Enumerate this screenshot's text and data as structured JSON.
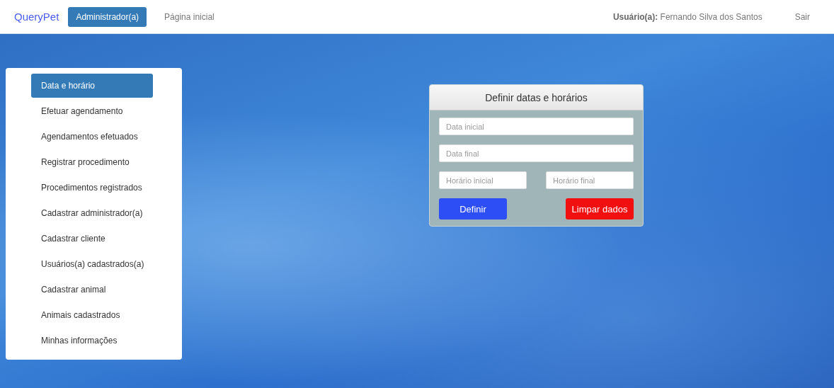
{
  "navbar": {
    "brand": "QueryPet",
    "tabs": [
      {
        "label": "Administrador(a)",
        "selected": true
      },
      {
        "label": "Página inicial",
        "selected": false
      }
    ],
    "user": "**Usuário(a):** Fernando Silva dos Santos",
    "logout": "Sair"
  },
  "sidebar": {
    "items": [
      {
        "label": "Data e horário",
        "selected": true
      },
      {
        "label": "Efetuar agendamento",
        "selected": false
      },
      {
        "label": "Agendamentos efetuados",
        "selected": false
      },
      {
        "label": "Registrar procedimento",
        "selected": false
      },
      {
        "label": "Procedimentos registrados",
        "selected": false
      },
      {
        "label": "Cadastrar administrador(a)",
        "selected": false
      },
      {
        "label": "Cadastrar cliente",
        "selected": false
      },
      {
        "label": "Usuários(a) cadastrados(a)",
        "selected": false
      },
      {
        "label": "Cadastrar animal",
        "selected": false
      },
      {
        "label": "Animais cadastrados",
        "selected": false
      },
      {
        "label": "Minhas informações",
        "selected": false
      }
    ]
  },
  "form": {
    "title": "Definir datas e horários",
    "fields": [
      {
        "placeholder": "Data inicial"
      },
      {
        "placeholder": "Data final"
      }
    ],
    "time_fields": [
      {
        "placeholder": "Horário inicial"
      },
      {
        "placeholder": "Horário final"
      }
    ],
    "buttons": [
      {
        "label": "Definir",
        "kind": "primary"
      },
      {
        "label": "Limpar dados",
        "kind": "danger"
      }
    ]
  }
}
